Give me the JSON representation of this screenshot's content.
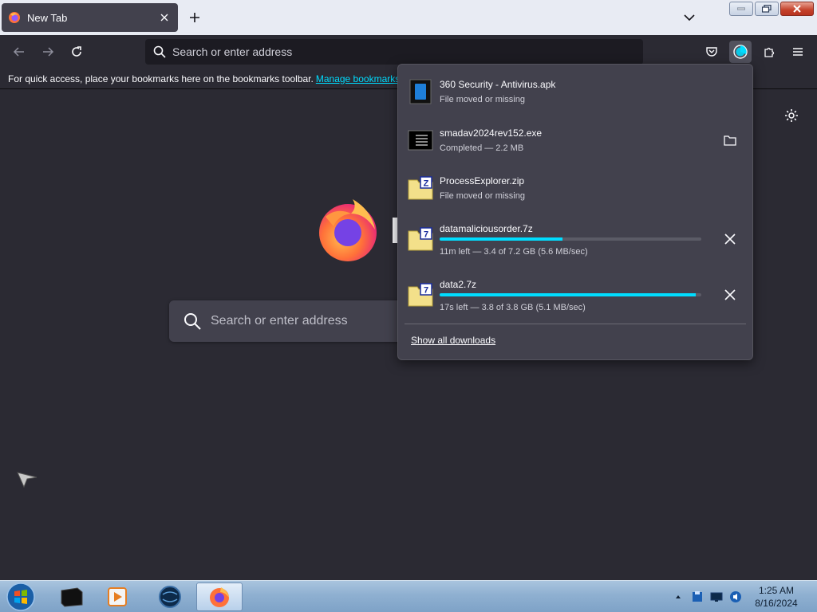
{
  "tab": {
    "title": "New Tab"
  },
  "urlbar": {
    "placeholder": "Search or enter address"
  },
  "bookmarks": {
    "message": "For quick access, place your bookmarks here on the bookmarks toolbar.",
    "link": "Manage bookmarks…"
  },
  "newtab": {
    "search_placeholder": "Search or enter address"
  },
  "downloads": {
    "items": [
      {
        "name": "360 Security - Antivirus.apk",
        "status": "File moved or missing",
        "icon": "apk-file-icon"
      },
      {
        "name": "smadav2024rev152.exe",
        "status": "Completed — 2.2 MB",
        "icon": "exe-file-icon",
        "action": "folder-icon"
      },
      {
        "name": "ProcessExplorer.zip",
        "status": "File moved or missing",
        "icon": "zip-file-icon"
      },
      {
        "name": "datamaliciousorder.7z",
        "status": "11m left — 3.4 of 7.2 GB (5.6 MB/sec)",
        "icon": "7z-file-icon",
        "progress": 0.47,
        "action": "cancel-icon"
      },
      {
        "name": "data2.7z",
        "status": "17s left — 3.8 of 3.8 GB (5.1 MB/sec)",
        "icon": "7z-file-icon",
        "progress": 0.98,
        "action": "cancel-icon"
      }
    ],
    "show_all": "Show all downloads"
  },
  "taskbar": {
    "clock_time": "1:25 AM",
    "clock_date": "8/16/2024"
  },
  "colors": {
    "accent": "#00ddff",
    "panel": "#42414d",
    "page": "#2b2a33",
    "url_bg": "#1c1b22"
  }
}
